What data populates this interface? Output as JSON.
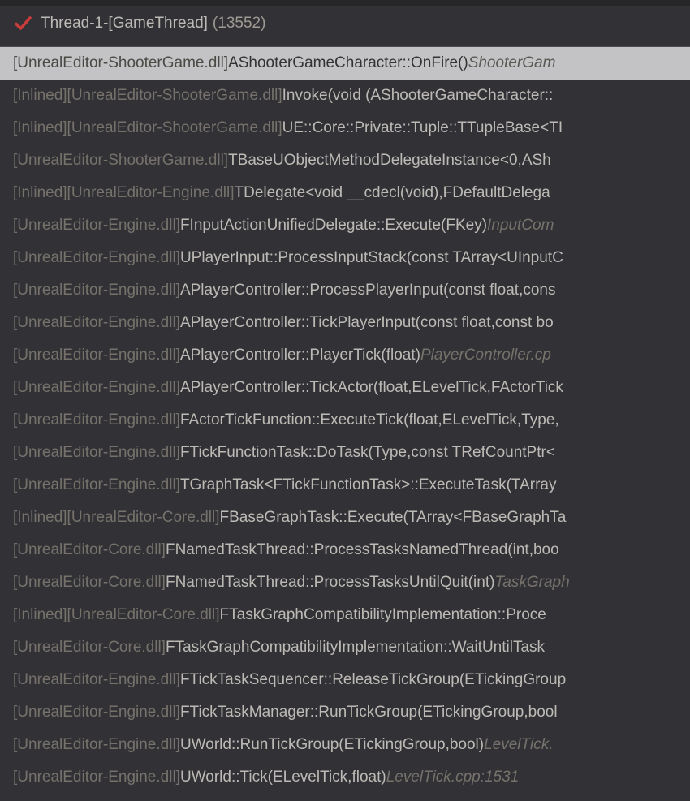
{
  "thread": {
    "name": "Thread-1-[GameThread]",
    "tid": "(13552)"
  },
  "frames": [
    {
      "selected": true,
      "inlined": "",
      "module": "[UnrealEditor-ShooterGame.dll] ",
      "func": "AShooterGameCharacter::OnFire() ",
      "source": "ShooterGam"
    },
    {
      "selected": false,
      "inlined": "[Inlined] ",
      "module": "[UnrealEditor-ShooterGame.dll] ",
      "func": "Invoke(void (AShooterGameCharacter::",
      "source": ""
    },
    {
      "selected": false,
      "inlined": "[Inlined] ",
      "module": "[UnrealEditor-ShooterGame.dll] ",
      "func": "UE::Core::Private::Tuple::TTupleBase<TI",
      "source": ""
    },
    {
      "selected": false,
      "inlined": "",
      "module": "[UnrealEditor-ShooterGame.dll] ",
      "func": "TBaseUObjectMethodDelegateInstance<0,ASh",
      "source": ""
    },
    {
      "selected": false,
      "inlined": "[Inlined] ",
      "module": "[UnrealEditor-Engine.dll] ",
      "func": "TDelegate<void __cdecl(void),FDefaultDelega",
      "source": ""
    },
    {
      "selected": false,
      "inlined": "",
      "module": "[UnrealEditor-Engine.dll] ",
      "func": "FInputActionUnifiedDelegate::Execute(FKey) ",
      "source": "InputCom"
    },
    {
      "selected": false,
      "inlined": "",
      "module": "[UnrealEditor-Engine.dll] ",
      "func": "UPlayerInput::ProcessInputStack(const TArray<UInputC",
      "source": ""
    },
    {
      "selected": false,
      "inlined": "",
      "module": "[UnrealEditor-Engine.dll] ",
      "func": "APlayerController::ProcessPlayerInput(const float,cons",
      "source": ""
    },
    {
      "selected": false,
      "inlined": "",
      "module": "[UnrealEditor-Engine.dll] ",
      "func": "APlayerController::TickPlayerInput(const float,const bo",
      "source": ""
    },
    {
      "selected": false,
      "inlined": "",
      "module": "[UnrealEditor-Engine.dll] ",
      "func": "APlayerController::PlayerTick(float) ",
      "source": "PlayerController.cp"
    },
    {
      "selected": false,
      "inlined": "",
      "module": "[UnrealEditor-Engine.dll] ",
      "func": "APlayerController::TickActor(float,ELevelTick,FActorTick",
      "source": ""
    },
    {
      "selected": false,
      "inlined": "",
      "module": "[UnrealEditor-Engine.dll] ",
      "func": "FActorTickFunction::ExecuteTick(float,ELevelTick,Type,",
      "source": ""
    },
    {
      "selected": false,
      "inlined": "",
      "module": "[UnrealEditor-Engine.dll] ",
      "func": "FTickFunctionTask::DoTask(Type,const TRefCountPtr<",
      "source": ""
    },
    {
      "selected": false,
      "inlined": "",
      "module": "[UnrealEditor-Engine.dll] ",
      "func": "TGraphTask<FTickFunctionTask>::ExecuteTask(TArray",
      "source": ""
    },
    {
      "selected": false,
      "inlined": "[Inlined] ",
      "module": "[UnrealEditor-Core.dll] ",
      "func": "FBaseGraphTask::Execute(TArray<FBaseGraphTa",
      "source": ""
    },
    {
      "selected": false,
      "inlined": "",
      "module": "[UnrealEditor-Core.dll] ",
      "func": "FNamedTaskThread::ProcessTasksNamedThread(int,boo",
      "source": ""
    },
    {
      "selected": false,
      "inlined": "",
      "module": "[UnrealEditor-Core.dll] ",
      "func": "FNamedTaskThread::ProcessTasksUntilQuit(int) ",
      "source": "TaskGraph"
    },
    {
      "selected": false,
      "inlined": "[Inlined] ",
      "module": "[UnrealEditor-Core.dll] ",
      "func": "FTaskGraphCompatibilityImplementation::Proce",
      "source": ""
    },
    {
      "selected": false,
      "inlined": "",
      "module": "[UnrealEditor-Core.dll] ",
      "func": "FTaskGraphCompatibilityImplementation::WaitUntilTask",
      "source": ""
    },
    {
      "selected": false,
      "inlined": "",
      "module": "[UnrealEditor-Engine.dll] ",
      "func": "FTickTaskSequencer::ReleaseTickGroup(ETickingGroup",
      "source": ""
    },
    {
      "selected": false,
      "inlined": "",
      "module": "[UnrealEditor-Engine.dll] ",
      "func": "FTickTaskManager::RunTickGroup(ETickingGroup,bool",
      "source": ""
    },
    {
      "selected": false,
      "inlined": "",
      "module": "[UnrealEditor-Engine.dll] ",
      "func": "UWorld::RunTickGroup(ETickingGroup,bool) ",
      "source": "LevelTick."
    },
    {
      "selected": false,
      "inlined": "",
      "module": "[UnrealEditor-Engine.dll] ",
      "func": "UWorld::Tick(ELevelTick,float) ",
      "source": "LevelTick.cpp:1531"
    }
  ]
}
